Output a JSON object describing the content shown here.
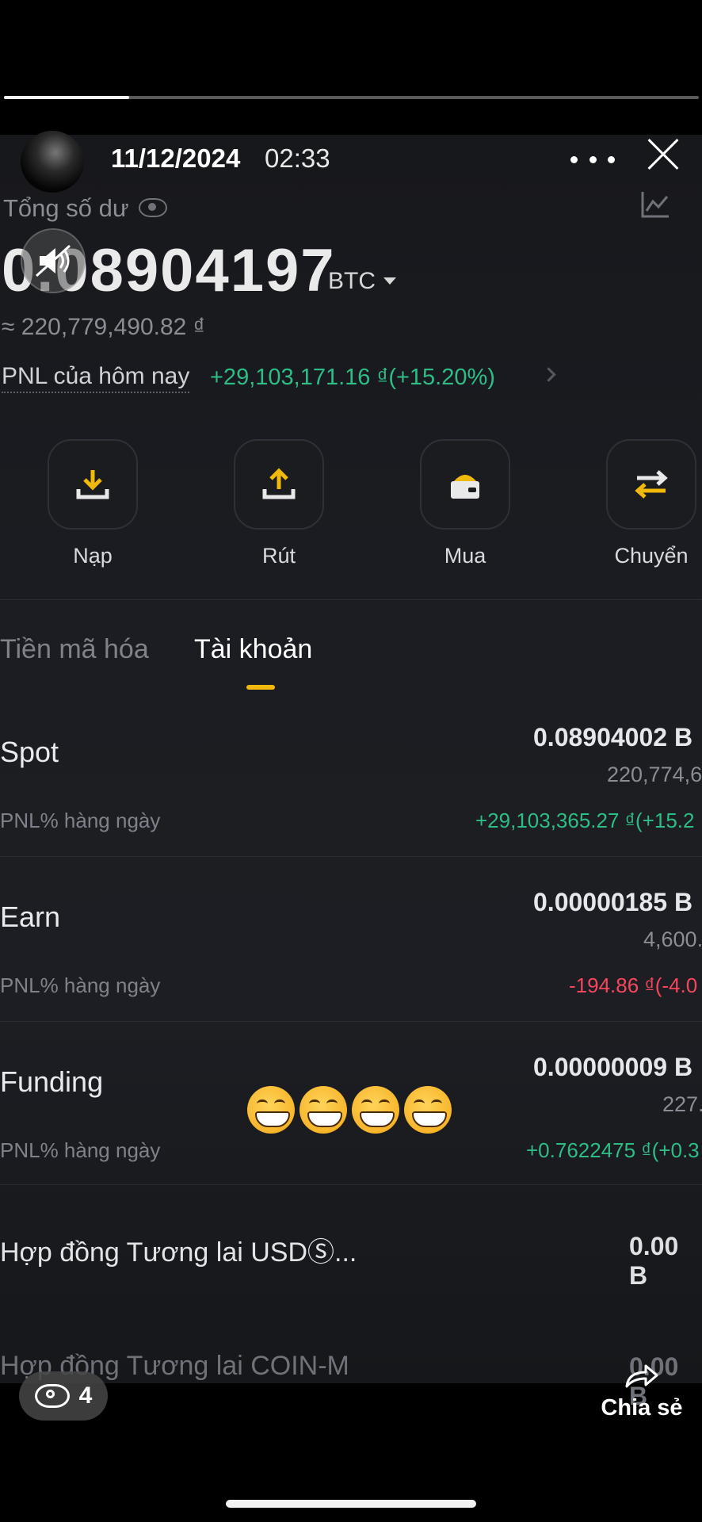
{
  "story": {
    "progress_fraction": 0.18,
    "date": "11/12/2024",
    "time": "02:33",
    "viewers": "4",
    "share_label": "Chia sẻ"
  },
  "wallet": {
    "balance_label": "Tổng số dư",
    "balance_value": "0.08904197",
    "balance_unit": "BTC",
    "fiat_value": "≈ 220,779,490.82 ₫",
    "pnl_label": "PNL của hôm nay",
    "pnl_value": "+29,103,171.16 ₫(+15.20%)"
  },
  "actions": [
    {
      "label": "Nạp",
      "icon": "deposit-icon"
    },
    {
      "label": "Rút",
      "icon": "withdraw-icon"
    },
    {
      "label": "Mua",
      "icon": "buy-icon"
    },
    {
      "label": "Chuyển",
      "icon": "transfer-icon"
    }
  ],
  "tabs": [
    {
      "label": "Tiền mã hóa",
      "active": false
    },
    {
      "label": "Tài khoản",
      "active": true
    }
  ],
  "accounts": [
    {
      "name": "Spot",
      "btc": "0.08904002 B",
      "fiat": "220,774,6",
      "pnl_label": "PNL% hàng ngày",
      "pnl": "+29,103,365.27 ₫(+15.2",
      "pnl_color": "#2ebd85"
    },
    {
      "name": "Earn",
      "btc": "0.00000185 B",
      "fiat": "4,600.",
      "pnl_label": "PNL% hàng ngày",
      "pnl": "-194.86 ₫(-4.0",
      "pnl_color": "#f6465d"
    },
    {
      "name": "Funding",
      "btc": "0.00000009 B",
      "fiat": "227.",
      "pnl_label": "PNL% hàng ngày",
      "pnl": "+0.7622475 ₫(+0.3",
      "pnl_color": "#2ebd85"
    }
  ],
  "futures": [
    {
      "name": "Hợp đồng Tương lai USDⓈ...",
      "value": "0.00 B"
    },
    {
      "name": "Hợp đồng Tương lai COIN-M",
      "value": "0.00 B"
    }
  ],
  "colors": {
    "accent": "#f0b90b",
    "positive": "#2ebd85",
    "negative": "#f6465d",
    "background": "#1b1d22"
  }
}
